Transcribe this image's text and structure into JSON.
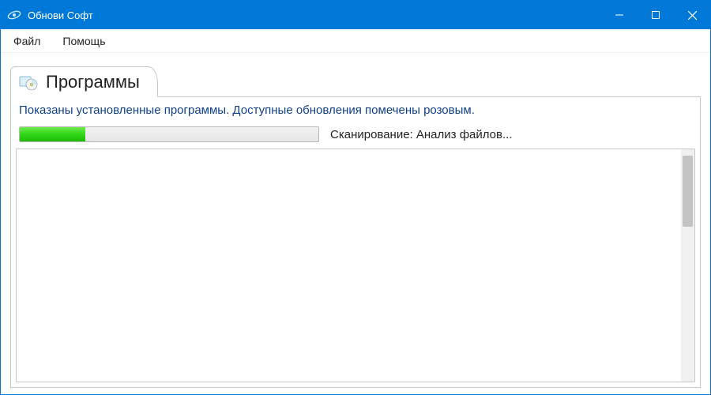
{
  "window": {
    "title": "Обнови Софт"
  },
  "menu": {
    "file": "Файл",
    "help": "Помощь"
  },
  "tab": {
    "programs_label": "Программы"
  },
  "main": {
    "info_text": "Показаны установленные программы. Доступные обновления помечены розовым.",
    "scan_text": "Сканирование: Анализ файлов...",
    "progress_percent": 22
  },
  "colors": {
    "titlebar": "#0078d7",
    "link_text": "#103f8a",
    "progress_fill": "#2fd816"
  }
}
